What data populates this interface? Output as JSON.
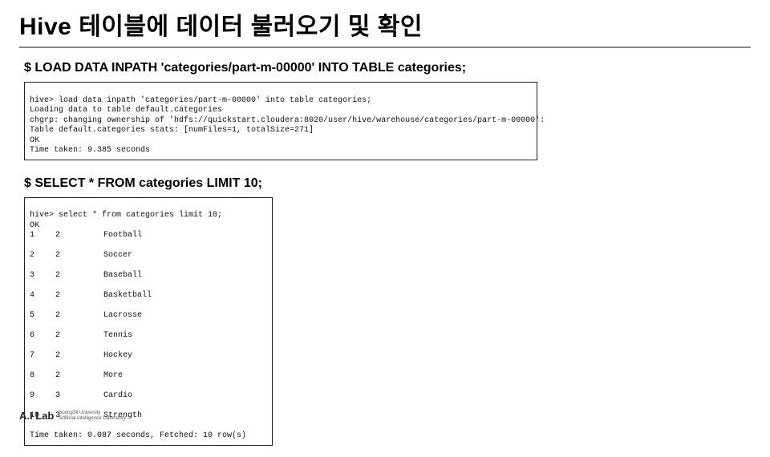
{
  "title": "Hive 테이블에 데이터 불러오기 및 확인",
  "commands": {
    "load": "$  LOAD DATA INPATH 'categories/part-m-00000' INTO TABLE categories;",
    "select": "$  SELECT * FROM categories LIMIT 10;"
  },
  "terminal_load": {
    "prompt": "hive> load data inpath 'categories/part-m-00000' into table categories;",
    "lines": [
      "Loading data to table default.categories",
      "chgrp: changing ownership of 'hdfs://quickstart.cloudera:8020/user/hive/warehouse/categories/part-m-00000':",
      "Table default.categories stats: [numFiles=1, totalSize=271]",
      "OK",
      "Time taken: 9.385 seconds"
    ]
  },
  "terminal_select": {
    "prompt": "hive> select * from categories limit 10;",
    "ok": "OK",
    "rows": [
      {
        "id": "1",
        "gid": "2",
        "name": "Football"
      },
      {
        "id": "2",
        "gid": "2",
        "name": "Soccer"
      },
      {
        "id": "3",
        "gid": "2",
        "name": "Baseball"
      },
      {
        "id": "4",
        "gid": "2",
        "name": "Basketball"
      },
      {
        "id": "5",
        "gid": "2",
        "name": "Lacrosse"
      },
      {
        "id": "6",
        "gid": "2",
        "name": "Tennis"
      },
      {
        "id": "7",
        "gid": "2",
        "name": "Hockey"
      },
      {
        "id": "8",
        "gid": "2",
        "name": "More"
      },
      {
        "id": "9",
        "gid": "3",
        "name": "Cardio"
      },
      {
        "id": "10",
        "gid": "3",
        "name": "Strength"
      }
    ],
    "footer": "Time taken: 0.087 seconds, Fetched: 10 row(s)"
  },
  "footer": {
    "logo_a": "A",
    "logo_dot": ".",
    "logo_i": "I",
    "logo_lab": " Lab",
    "sub1": "SoongSil University",
    "sub2": "Artificial Intelligence Laboratory"
  }
}
